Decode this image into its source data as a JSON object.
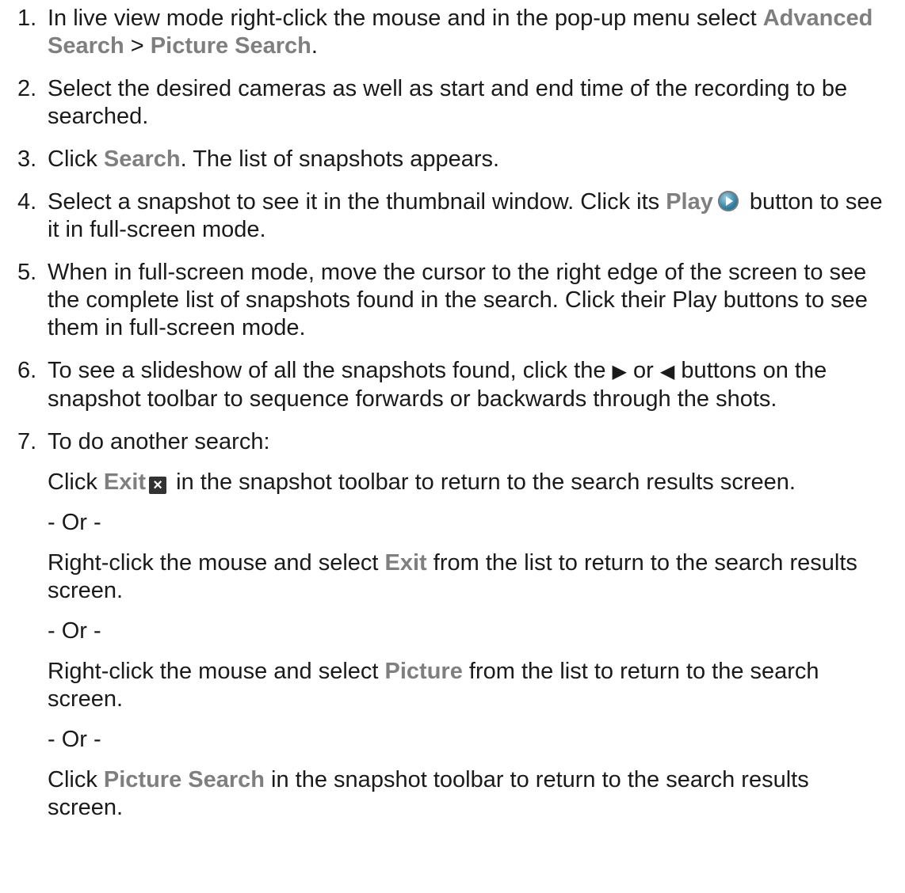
{
  "steps": [
    {
      "num": "1.",
      "t1": "In live view mode right-click the mouse and in the pop-up menu select ",
      "b1": "Advanced Search",
      "t2": " > ",
      "b2": "Picture Search",
      "t3": "."
    },
    {
      "num": "2.",
      "t1": "Select the desired cameras as well as start and end time of the recording to be searched."
    },
    {
      "num": "3.",
      "t1": "Click ",
      "b1": "Search",
      "t2": ". The list of snapshots appears."
    },
    {
      "num": "4.",
      "t1": "Select a snapshot to see it in the thumbnail window. Click its ",
      "b1": "Play",
      "t2": " button to see it in full-screen mode."
    },
    {
      "num": "5.",
      "t1": "When in full-screen mode, move the cursor to the right edge of the screen to see the complete list of snapshots found in the search. Click their Play buttons to see them in full-screen mode."
    },
    {
      "num": "6.",
      "t1": "To see a slideshow of all the snapshots found, click the ",
      "arrow1": "▶",
      "t2": " or ",
      "arrow2": "◀",
      "t3": " buttons on the snapshot toolbar to sequence forwards or backwards through the shots."
    },
    {
      "num": "7.",
      "t1": "To do another search:",
      "sub": [
        {
          "t1": "Click ",
          "b1": "Exit",
          "t2": " in the snapshot toolbar to return to the search results screen."
        },
        {
          "t1": "- Or -"
        },
        {
          "t1": "Right-click the mouse and select ",
          "b1": "Exit",
          "t2": " from the list to return to the search results screen."
        },
        {
          "t1": "- Or -"
        },
        {
          "t1": "Right-click the mouse and select ",
          "b1": "Picture",
          "t2": " from the list to return to the search screen."
        },
        {
          "t1": "- Or -"
        },
        {
          "t1": "Click ",
          "b1": "Picture Search",
          "t2": " in the snapshot toolbar to return to the search results screen."
        }
      ]
    }
  ],
  "icons": {
    "play_icon": "play-circle-icon",
    "exit_icon": "close-x-icon",
    "exit_glyph": "×"
  }
}
